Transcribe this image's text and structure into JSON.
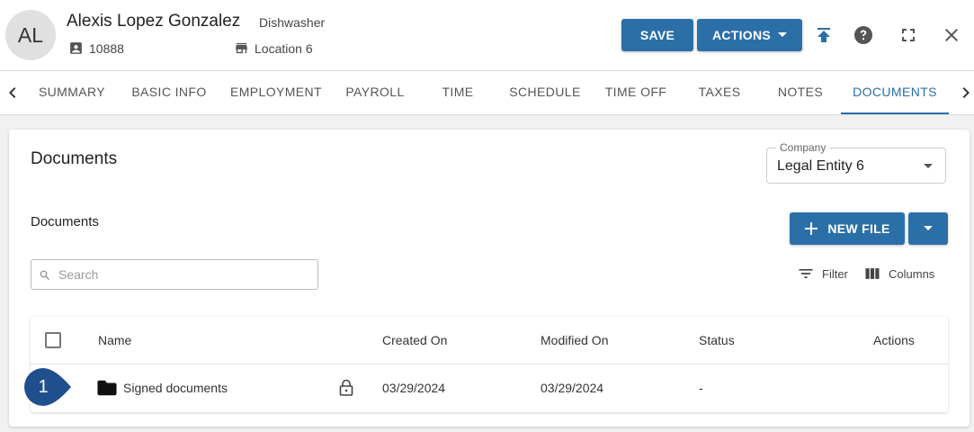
{
  "header": {
    "avatar_initials": "AL",
    "employee_name": "Alexis Lopez Gonzalez",
    "employee_title": "Dishwasher",
    "employee_id": "10888",
    "location": "Location 6",
    "save_label": "SAVE",
    "actions_label": "ACTIONS"
  },
  "tabs": [
    {
      "label": "SUMMARY"
    },
    {
      "label": "BASIC INFO"
    },
    {
      "label": "EMPLOYMENT"
    },
    {
      "label": "PAYROLL"
    },
    {
      "label": "TIME"
    },
    {
      "label": "SCHEDULE"
    },
    {
      "label": "TIME OFF"
    },
    {
      "label": "TAXES"
    },
    {
      "label": "NOTES"
    },
    {
      "label": "DOCUMENTS"
    }
  ],
  "active_tab": "DOCUMENTS",
  "documents": {
    "card_title": "Documents",
    "company_label": "Company",
    "company_value": "Legal Entity 6",
    "section_title": "Documents",
    "new_file_label": "NEW FILE",
    "search_placeholder": "Search",
    "filter_label": "Filter",
    "columns_label": "Columns",
    "table": {
      "headers": {
        "name": "Name",
        "created_on": "Created On",
        "modified_on": "Modified On",
        "status": "Status",
        "actions": "Actions"
      },
      "rows": [
        {
          "name": "Signed documents",
          "created_on": "03/29/2024",
          "modified_on": "03/29/2024",
          "status": "-"
        }
      ]
    }
  },
  "callout": {
    "number": "1"
  },
  "colors": {
    "primary": "#2b6fa8",
    "callout": "#1f4f8c"
  }
}
